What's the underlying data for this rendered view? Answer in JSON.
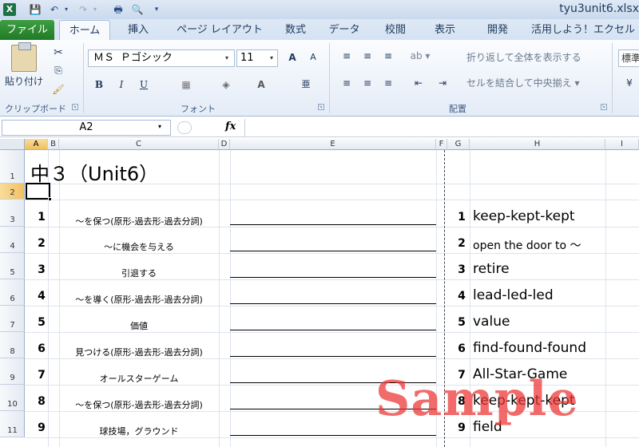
{
  "window": {
    "file_title": "tyu3unit6.xlsx",
    "app_icon": "X",
    "quick_access": {
      "save": "💾",
      "undo": "↶",
      "dropdown": "▾",
      "redo": "↷",
      "print": "🖶",
      "preview": "🔍",
      "customize": "▾"
    }
  },
  "tabs": [
    {
      "label": "ファイル"
    },
    {
      "label": "ホーム"
    },
    {
      "label": "挿入"
    },
    {
      "label": "ページ レイアウト"
    },
    {
      "label": "数式"
    },
    {
      "label": "データ"
    },
    {
      "label": "校閲"
    },
    {
      "label": "表示"
    },
    {
      "label": "開発"
    },
    {
      "label": "活用しよう！エクセル"
    }
  ],
  "ribbon": {
    "clipboard": {
      "paste": "貼り付け",
      "cut_icon": "✂",
      "copy_icon": "⎘",
      "format_painter_icon": "🖌",
      "group": "クリップボード"
    },
    "font": {
      "name": "ＭＳ Ｐゴシック",
      "size": "11",
      "grow": "A",
      "shrink": "A",
      "bold": "B",
      "italic": "I",
      "underline": "U",
      "border_icon": "▦",
      "fill_icon": "◈",
      "color_icon": "A",
      "phonetic_icon": "亜",
      "group": "フォント"
    },
    "alignment": {
      "top": "≡",
      "middle": "≡",
      "bottom": "≡",
      "orientation": "ab ▾",
      "left": "≡",
      "center": "≡",
      "right": "≡",
      "indent_dec": "⇤",
      "indent_inc": "⇥",
      "wrap_text": "折り返して全体を表示する",
      "merge_center": "セルを結合して中央揃え ▾",
      "group": "配置"
    },
    "number": {
      "format": "標準",
      "icon": "¥"
    },
    "launcher": "↘"
  },
  "formula_bar": {
    "name_box": "A2",
    "fx": "fx",
    "formula": ""
  },
  "grid": {
    "columns": [
      "A",
      "B",
      "C",
      "D",
      "E",
      "F",
      "G",
      "H",
      "I"
    ],
    "selected_column": "A",
    "rows": [
      "1",
      "2",
      "3",
      "4",
      "5",
      "6",
      "7",
      "8",
      "9",
      "10",
      "11"
    ],
    "selected_row": "2"
  },
  "sheet": {
    "title": "中３（Unit6）",
    "questions": [
      {
        "no": "1",
        "prompt": "～を保つ(原形-過去形-過去分詞)",
        "answer_no": "1",
        "answer": "keep-kept-kept"
      },
      {
        "no": "2",
        "prompt": "～に機会を与える",
        "answer_no": "2",
        "answer": "open the door to ～"
      },
      {
        "no": "3",
        "prompt": "引退する",
        "answer_no": "3",
        "answer": "retire"
      },
      {
        "no": "4",
        "prompt": "～を導く(原形-過去形-過去分詞)",
        "answer_no": "4",
        "answer": "lead-led-led"
      },
      {
        "no": "5",
        "prompt": "価値",
        "answer_no": "5",
        "answer": "value"
      },
      {
        "no": "6",
        "prompt": "見つける(原形-過去形-過去分詞)",
        "answer_no": "6",
        "answer": "find-found-found"
      },
      {
        "no": "7",
        "prompt": "オールスターゲーム",
        "answer_no": "7",
        "answer": "All-Star-Game"
      },
      {
        "no": "8",
        "prompt": "～を保つ(原形-過去形-過去分詞)",
        "answer_no": "8",
        "answer": "keep-kept-kept"
      },
      {
        "no": "9",
        "prompt": "球技場，グラウンド",
        "answer_no": "9",
        "answer": "field"
      }
    ]
  },
  "watermark": "Sample"
}
